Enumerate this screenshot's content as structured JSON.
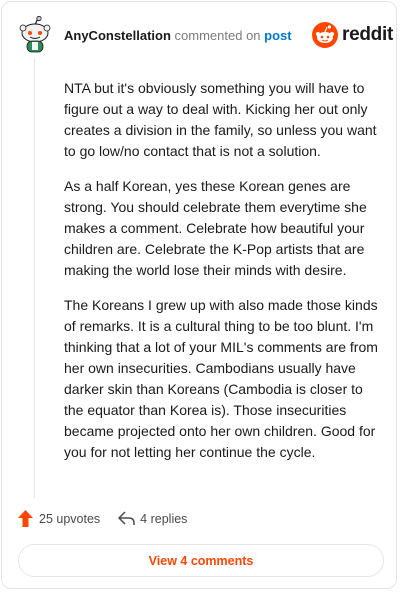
{
  "header": {
    "username": "AnyConstellation",
    "action_text": "commented on",
    "post_link": "post",
    "brand": "reddit"
  },
  "comment": {
    "paragraphs": [
      "NTA but it's obviously something you will have to figure out a way to deal with. Kicking her out only creates a division in the family, so unless you want to go low/no contact that is not a solution.",
      "As a half Korean, yes these Korean genes are strong. You should celebrate them everytime she makes a comment. Celebrate how beautiful your children are. Celebrate the K-Pop artists that are making the world lose their minds with desire.",
      "The Koreans I grew up with also made those kinds of remarks. It is a cultural thing to be too blunt. I'm thinking that a lot of your MIL's comments are from her own insecurities. Cambodians usually have darker skin than Koreans (Cambodia is closer to the equator than Korea is). Those insecurities became projected onto her own children. Good for you for not letting her continue the cycle."
    ]
  },
  "footer": {
    "upvotes": "25 upvotes",
    "replies": "4 replies",
    "view_comments": "View 4 comments"
  },
  "icons": {
    "avatar": "snoo-avatar-icon",
    "logo": "reddit-logo-icon",
    "upvote": "upvote-arrow-icon",
    "reply": "reply-arrow-icon"
  },
  "colors": {
    "brand_orange": "#ff4500",
    "link_blue": "#0079d3",
    "text": "#1a1a1b",
    "muted": "#7c7c7c"
  }
}
